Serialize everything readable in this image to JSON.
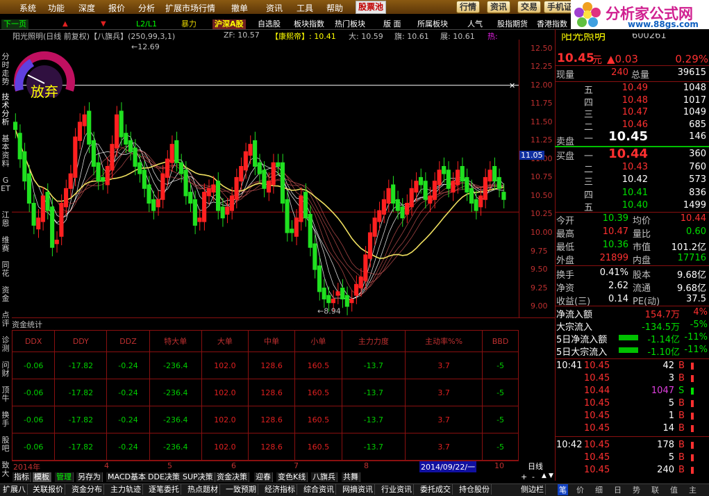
{
  "menu": {
    "items": [
      "系统",
      "功能",
      "深度",
      "报价",
      "分析",
      "扩展市场行情",
      "撤单",
      "资讯",
      "工具",
      "帮助"
    ],
    "selected": "股票池"
  },
  "top_buttons": [
    "行情",
    "资讯",
    "交易",
    "手机证"
  ],
  "logo": {
    "brand": "分析家公式网",
    "url": "www.88gs.com"
  },
  "toolbar": {
    "items": [
      "下一页",
      "L2/L1",
      "暴力",
      "沪深A股",
      "自选股",
      "板块指数",
      "热门板块",
      "版 面",
      "所属板块",
      "人气",
      "股指期货",
      "香港指数"
    ]
  },
  "left_tabs": [
    "分时走势",
    "技术分析",
    "基本资料",
    "GET",
    "江恩",
    "维赛",
    "同花",
    "资金",
    "点评",
    "诊测",
    "问财",
    "顶牛",
    "换手",
    "股吧",
    "致大"
  ],
  "info_line": {
    "title": "阳光照明(日线 前复权)【八旗兵】(250,99,3,1)",
    "zf": "ZF: 10.57",
    "kangxi": "【康熙帝】: 10.41",
    "da": "大: 10.59",
    "qi": "旗: 10.61",
    "zhan": "展: 10.61",
    "re": "热:"
  },
  "gauge_label": "放弃",
  "chart_data": {
    "type": "candlestick",
    "ylim": [
      8.85,
      12.62
    ],
    "yticks": [
      "12.50",
      "12.25",
      "12.00",
      "11.75",
      "11.50",
      "11.25",
      "11.00",
      "10.75",
      "10.50",
      "10.25",
      "10.00",
      "9.75",
      "9.50",
      "9.25",
      "9.00"
    ],
    "high_label": "12.69",
    "low_label": "8.94",
    "current_price_label": "11.05",
    "ref_line_label": "1",
    "xlabels": [
      "2014年",
      "4",
      "5",
      "6",
      "7",
      "8",
      "2014/09/22/一",
      "10"
    ],
    "candles_close": [
      11.4,
      11.0,
      10.7,
      10.4,
      10.1,
      10.2,
      10.5,
      10.3,
      9.8,
      9.9,
      10.4,
      10.6,
      10.8,
      11.3,
      11.5,
      11.6,
      11.2,
      10.9,
      10.7,
      10.7,
      10.9,
      11.2,
      11.6,
      11.3,
      11.2,
      11.1,
      10.9,
      10.8,
      10.6,
      10.4,
      10.3,
      10.45,
      10.8,
      11.0,
      11.2,
      10.95,
      10.8,
      10.5,
      10.4,
      10.1,
      10.2,
      10.55,
      10.6,
      10.65,
      10.3,
      10.2,
      10.35,
      10.5,
      10.75,
      10.9,
      11.1,
      11.2,
      10.9,
      10.8,
      10.6,
      10.7,
      10.95,
      10.9,
      10.4,
      10.0,
      10.0,
      10.2,
      10.5,
      10.2,
      9.8,
      9.5,
      9.2,
      9.1,
      9.05,
      9.1,
      9.2,
      9.1,
      9.0,
      9.1,
      9.3,
      9.4,
      9.7,
      10.0,
      10.2,
      10.3,
      10.45,
      10.6,
      10.4,
      10.3,
      10.2,
      10.4,
      10.6,
      10.7,
      10.65,
      10.45,
      10.5,
      10.7,
      10.85,
      10.8,
      10.6,
      10.7,
      10.85,
      10.7,
      10.55,
      10.4,
      10.3,
      10.5,
      10.75,
      10.85,
      10.7,
      10.6,
      10.45
    ],
    "candles_open": [
      11.5,
      11.35,
      11.1,
      10.8,
      10.4,
      10.05,
      10.15,
      10.55,
      10.35,
      9.85,
      9.95,
      10.35,
      10.6,
      10.75,
      11.25,
      11.45,
      11.65,
      11.25,
      10.95,
      10.75,
      10.65,
      10.85,
      11.15,
      11.65,
      11.35,
      11.25,
      11.15,
      10.95,
      10.85,
      10.65,
      10.45,
      10.35,
      10.45,
      10.75,
      10.95,
      11.25,
      10.95,
      10.85,
      10.55,
      10.45,
      10.15,
      10.15,
      10.5,
      10.55,
      10.7,
      10.35,
      10.25,
      10.3,
      10.45,
      10.7,
      10.85,
      11.05,
      11.25,
      10.95,
      10.85,
      10.55,
      10.65,
      10.95,
      10.95,
      10.45,
      10.05,
      9.95,
      10.15,
      10.55,
      10.25,
      9.85,
      9.55,
      9.25,
      9.15,
      9.05,
      9.15,
      9.25,
      9.15,
      9.05,
      9.15,
      9.25,
      9.35,
      9.65,
      9.95,
      10.15,
      10.25,
      10.4,
      10.65,
      10.45,
      10.35,
      10.25,
      10.35,
      10.55,
      10.75,
      10.7,
      10.4,
      10.45,
      10.65,
      10.9,
      10.85,
      10.55,
      10.65,
      10.9,
      10.75,
      10.6,
      10.45,
      10.35,
      10.45,
      10.7,
      10.9,
      10.75,
      10.55
    ]
  },
  "flow": {
    "title": "资金统计",
    "headers": [
      "DDX",
      "DDY",
      "DDZ",
      "特大单",
      "大单",
      "中单",
      "小单",
      "主力力度",
      "主动率%%",
      "BBD"
    ],
    "header_colors": [
      "#c03030",
      "#c03030",
      "#c03030",
      "#c03030",
      "#c03030",
      "#c03030",
      "#c03030",
      "#c03030",
      "#c03030",
      "#c03030"
    ],
    "rows": [
      [
        "-0.06",
        "-17.82",
        "-0.24",
        "-236.4",
        "102.0",
        "128.6",
        "160.5",
        "-13.7",
        "3.7",
        "-5"
      ],
      [
        "-0.06",
        "-17.82",
        "-0.24",
        "-236.4",
        "102.0",
        "128.6",
        "160.5",
        "-13.7",
        "3.7",
        "-5"
      ],
      [
        "-0.06",
        "-17.82",
        "-0.24",
        "-236.4",
        "102.0",
        "128.6",
        "160.5",
        "-13.7",
        "3.7",
        "-5"
      ],
      [
        "-0.06",
        "-17.82",
        "-0.24",
        "-236.4",
        "102.0",
        "128.6",
        "160.5",
        "-13.7",
        "3.7",
        "-5"
      ]
    ],
    "cell_colors": [
      "c-green",
      "c-green",
      "c-green",
      "c-green",
      "c-red",
      "c-red",
      "c-red",
      "c-green",
      "c-red",
      "c-green"
    ]
  },
  "bottom_tabs": [
    "指标",
    "模板",
    "管理",
    "另存为",
    "MACD基本",
    "DDE决策",
    "SUP决策",
    "资金决策",
    "迎春",
    "变色K线",
    "八旗兵",
    "共舞"
  ],
  "bottom_tabs2": [
    "扩展八",
    "关联报价",
    "资金分布",
    "主力轨迹",
    "逐笔委托",
    "热点题材",
    "一致预期",
    "经济指标",
    "综合资讯",
    "网摘资讯",
    "行业资讯",
    "委托成交",
    "持仓股份",
    "侧边栏"
  ],
  "period_label": "日线",
  "right_bottom_tabs": [
    "笔",
    "价",
    "细",
    "日",
    "势",
    "联",
    "值",
    "主"
  ],
  "quote": {
    "name": "阳光照明",
    "code": "600261",
    "price": "10.45",
    "unit": "元",
    "change": "▲0.03",
    "pct": "0.29%",
    "xianliang_label": "现量",
    "xianliang": "240",
    "zongliang_label": "总量",
    "zongliang": "39615",
    "asks": [
      {
        "label": "五",
        "price": "10.49",
        "vol": "1048"
      },
      {
        "label": "四",
        "price": "10.48",
        "vol": "1017"
      },
      {
        "label": "三",
        "price": "10.47",
        "vol": "1049"
      },
      {
        "label": "二",
        "price": "10.46",
        "vol": "685"
      },
      {
        "label": "一",
        "price": "10.45",
        "vol": "146"
      }
    ],
    "sell_label": "卖盘",
    "buy_label": "买盘",
    "bids": [
      {
        "label": "一",
        "price": "10.44",
        "vol": "360"
      },
      {
        "label": "二",
        "price": "10.43",
        "vol": "760"
      },
      {
        "label": "三",
        "price": "10.42",
        "vol": "573"
      },
      {
        "label": "四",
        "price": "10.41",
        "vol": "836"
      },
      {
        "label": "五",
        "price": "10.40",
        "vol": "1499"
      }
    ],
    "stats": [
      {
        "l1": "今开",
        "v1": "10.39",
        "l2": "均价",
        "v2": "10.44"
      },
      {
        "l1": "最高",
        "v1": "10.47",
        "l2": "量比",
        "v2": "0.60"
      },
      {
        "l1": "最低",
        "v1": "10.36",
        "l2": "市值",
        "v2": "101.2亿"
      },
      {
        "l1": "外盘",
        "v1": "21899",
        "l2": "内盘",
        "v2": "17716"
      },
      {
        "l1": "换手",
        "v1": "0.41%",
        "l2": "股本",
        "v2": "9.68亿"
      },
      {
        "l1": "净资",
        "v1": "2.62",
        "l2": "流通",
        "v2": "9.68亿"
      },
      {
        "l1": "收益(三)",
        "v1": "0.14",
        "l2": "PE(动)",
        "v2": "37.5"
      }
    ],
    "flows": [
      {
        "label": "净流入额",
        "value": "154.7万",
        "pct": "4%"
      },
      {
        "label": "大宗流入",
        "value": "-134.5万",
        "pct": "-5%"
      },
      {
        "label": "5日净流入额",
        "value": "-1.14亿",
        "pct": "-11%"
      },
      {
        "label": "5日大宗流入",
        "value": "-1.10亿",
        "pct": "-11%"
      }
    ],
    "ticks": [
      {
        "time": "10:41",
        "price": "10.45",
        "vol": "42",
        "bs": "B"
      },
      {
        "time": "",
        "price": "10.45",
        "vol": "3",
        "bs": "B"
      },
      {
        "time": "",
        "price": "10.44",
        "vol": "1047",
        "bs": "S"
      },
      {
        "time": "",
        "price": "10.45",
        "vol": "5",
        "bs": "B"
      },
      {
        "time": "",
        "price": "10.45",
        "vol": "1",
        "bs": "B"
      },
      {
        "time": "",
        "price": "10.45",
        "vol": "14",
        "bs": "B"
      },
      {
        "time": "10:42",
        "price": "10.45",
        "vol": "178",
        "bs": "B"
      },
      {
        "time": "",
        "price": "10.45",
        "vol": "5",
        "bs": "B"
      },
      {
        "time": "",
        "price": "10.45",
        "vol": "240",
        "bs": "B"
      }
    ]
  }
}
